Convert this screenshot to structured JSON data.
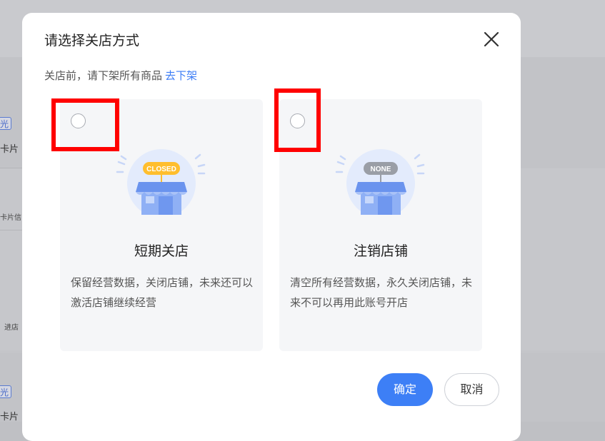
{
  "background": {
    "tag_labels": [
      "光",
      "光"
    ],
    "texts": [
      "卡片",
      "卡片信",
      "进店",
      "卡片"
    ]
  },
  "dialog": {
    "title": "请选择关店方式",
    "notice_text": "关店前，请下架所有商品",
    "notice_link": "去下架",
    "options": [
      {
        "title": "短期关店",
        "description": "保留经营数据，关闭店铺，未来还可以激活店铺继续经营",
        "badge": "CLOSED",
        "badge_color": "#ffbe2e",
        "selected": false
      },
      {
        "title": "注销店铺",
        "description": "清空所有经营数据，永久关闭店铺，未来不可以再用此账号开店",
        "badge": "NONE",
        "badge_color": "#9a9ea6",
        "selected": false
      }
    ],
    "confirm_label": "确定",
    "cancel_label": "取消",
    "colors": {
      "primary": "#3d7ff6",
      "link": "#3b7cf6",
      "highlight": "#ff0000"
    }
  }
}
